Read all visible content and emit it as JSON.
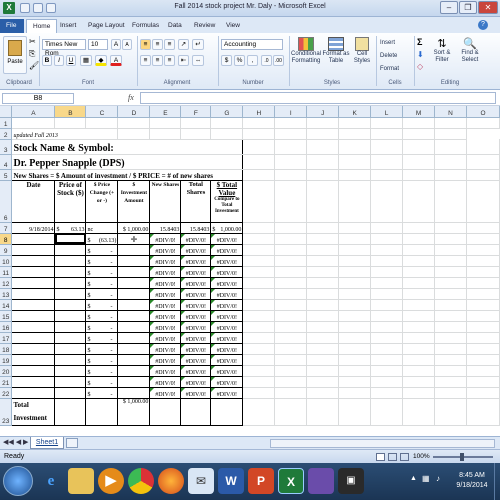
{
  "window": {
    "title": "Fall 2014 stock project Mr. Daly - Microsoft Excel"
  },
  "tabs": [
    "File",
    "Home",
    "Insert",
    "Page Layout",
    "Formulas",
    "Data",
    "Review",
    "View"
  ],
  "ribbon": {
    "clipboard": {
      "paste": "Paste",
      "label": "Clipboard"
    },
    "font": {
      "name": "Times New Rom",
      "size": "10",
      "label": "Font"
    },
    "alignment": {
      "label": "Alignment"
    },
    "number": {
      "format": "Accounting",
      "dollar": "$",
      "percent": "%",
      "comma": ",",
      "label": "Number"
    },
    "styles": {
      "conditional": "Conditional Formatting",
      "format_table": "Format as Table",
      "cell_styles": "Cell Styles",
      "label": "Styles"
    },
    "cells": {
      "insert": "Insert",
      "delete": "Delete",
      "format": "Format",
      "label": "Cells"
    },
    "editing": {
      "sort": "Sort & Filter",
      "find": "Find & Select",
      "label": "Editing"
    }
  },
  "formula_bar": {
    "name_box": "B8",
    "fx": "fx",
    "formula": ""
  },
  "columns": [
    "A",
    "B",
    "C",
    "D",
    "E",
    "F",
    "G",
    "H",
    "I",
    "J",
    "K",
    "L",
    "M",
    "N",
    "O"
  ],
  "sheet": {
    "r2_note": "updated Fall 2013",
    "r3_title": "Stock Name & Symbol:",
    "r4_company": "Dr. Pepper Snapple (DPS)",
    "r5_formula": "New Shares = $ Amount of investment / $ PRICE = # of new shares",
    "headers": {
      "date": "Date",
      "price": "Price of Stock ($)",
      "change": "$ Price Change (+ or -)",
      "investment": "$ Investment Amount",
      "new_shares": "New Shares",
      "total_shares": "Total Shares",
      "total_value": "$ Total Value",
      "total_value_sub": "Compare to Total Investment"
    },
    "row7": {
      "date": "9/18/2014",
      "price_sym": "$",
      "price": "63.13",
      "change": "nc",
      "investment": "$ 1,000.00",
      "new_shares": "15.8403",
      "total_shares": "15.8403",
      "value_sym": "$",
      "value": "1,000.00"
    },
    "row8": {
      "change_sym": "$",
      "change": "(63.13)",
      "new_shares": "#DIV/0!",
      "total_shares": "#DIV/0!",
      "value": "#DIV/0!"
    },
    "data_rows": [
      {
        "row": "9",
        "dollar": "$",
        "dash": "-",
        "err": "#DIV/0!"
      },
      {
        "row": "10",
        "dollar": "$",
        "dash": "-",
        "err": "#DIV/0!"
      },
      {
        "row": "11",
        "dollar": "$",
        "dash": "-",
        "err": "#DIV/0!"
      },
      {
        "row": "12",
        "dollar": "$",
        "dash": "-",
        "err": "#DIV/0!"
      },
      {
        "row": "13",
        "dollar": "$",
        "dash": "-",
        "err": "#DIV/0!"
      },
      {
        "row": "14",
        "dollar": "$",
        "dash": "-",
        "err": "#DIV/0!"
      },
      {
        "row": "15",
        "dollar": "$",
        "dash": "-",
        "err": "#DIV/0!"
      },
      {
        "row": "16",
        "dollar": "$",
        "dash": "-",
        "err": "#DIV/0!"
      },
      {
        "row": "17",
        "dollar": "$",
        "dash": "-",
        "err": "#DIV/0!"
      },
      {
        "row": "18",
        "dollar": "$",
        "dash": "-",
        "err": "#DIV/0!"
      },
      {
        "row": "19",
        "dollar": "$",
        "dash": "-",
        "err": "#DIV/0!"
      },
      {
        "row": "20",
        "dollar": "$",
        "dash": "-",
        "err": "#DIV/0!"
      },
      {
        "row": "21",
        "dollar": "$",
        "dash": "-",
        "err": "#DIV/0!"
      },
      {
        "row": "22",
        "dollar": "$",
        "dash": "-",
        "err": "#DIV/0!"
      }
    ],
    "total_label": "Total Investment",
    "total_amount": "$ 1,000.00"
  },
  "sheet_tabs": [
    "Sheet1"
  ],
  "status": {
    "ready": "Ready",
    "zoom": "100%"
  },
  "taskbar": {
    "time": "8:45 AM",
    "date": "9/18/2014"
  },
  "colors": {
    "ribbon_accent": "#dde8f6",
    "selection": "#f8d88a",
    "error_marker": "#2a8a2a"
  }
}
